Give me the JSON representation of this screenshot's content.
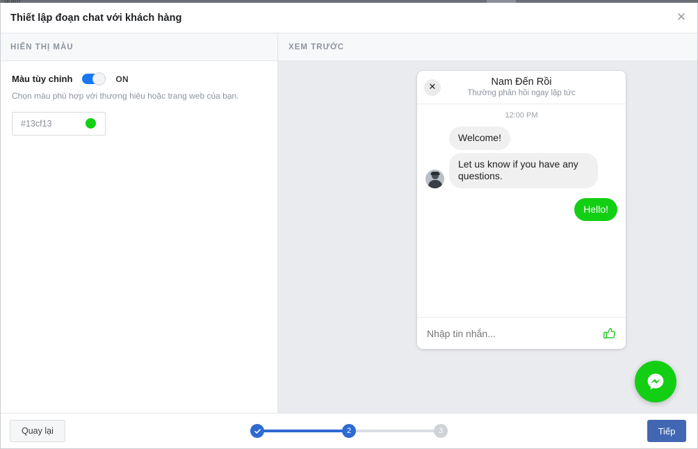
{
  "background": {
    "strip_label": "gram"
  },
  "modal": {
    "title": "Thiết lập đoạn chat với khách hàng",
    "close_icon": "close-icon",
    "close_glyph": "✕"
  },
  "columns": {
    "left_header": "HIỂN THỊ MÀU",
    "right_header": "XEM TRƯỚC"
  },
  "settings": {
    "toggle_label": "Màu tùy chỉnh",
    "toggle_state": "ON",
    "help_text": "Chọn màu phù hợp với thương hiệu hoặc trang web của bạn.",
    "color_value": "#13cf13",
    "accent_color": "#13cf13"
  },
  "preview": {
    "chat": {
      "close_icon": "close-icon",
      "close_glyph": "✕",
      "title": "Nam Đến Rồi",
      "subtitle": "Thường phản hồi ngay lập tức",
      "timestamp": "12:00 PM",
      "messages": [
        {
          "text": "Welcome!",
          "side": "in"
        },
        {
          "text": "Let us know if you have any questions.",
          "side": "in"
        },
        {
          "text": "Hello!",
          "side": "out"
        }
      ],
      "input_placeholder": "Nhập tin nhắn...",
      "thumb_icon": "thumbs-up-icon"
    },
    "fab_icon": "messenger-icon",
    "fab_color": "#13cf13"
  },
  "footer": {
    "back_label": "Quay lại",
    "next_label": "Tiếp",
    "steps": [
      {
        "label": "✓",
        "state": "done"
      },
      {
        "label": "2",
        "state": "active"
      },
      {
        "label": "3",
        "state": "todo"
      }
    ],
    "primary_color": "#4267b2",
    "step_color": "#2e6ad1"
  }
}
